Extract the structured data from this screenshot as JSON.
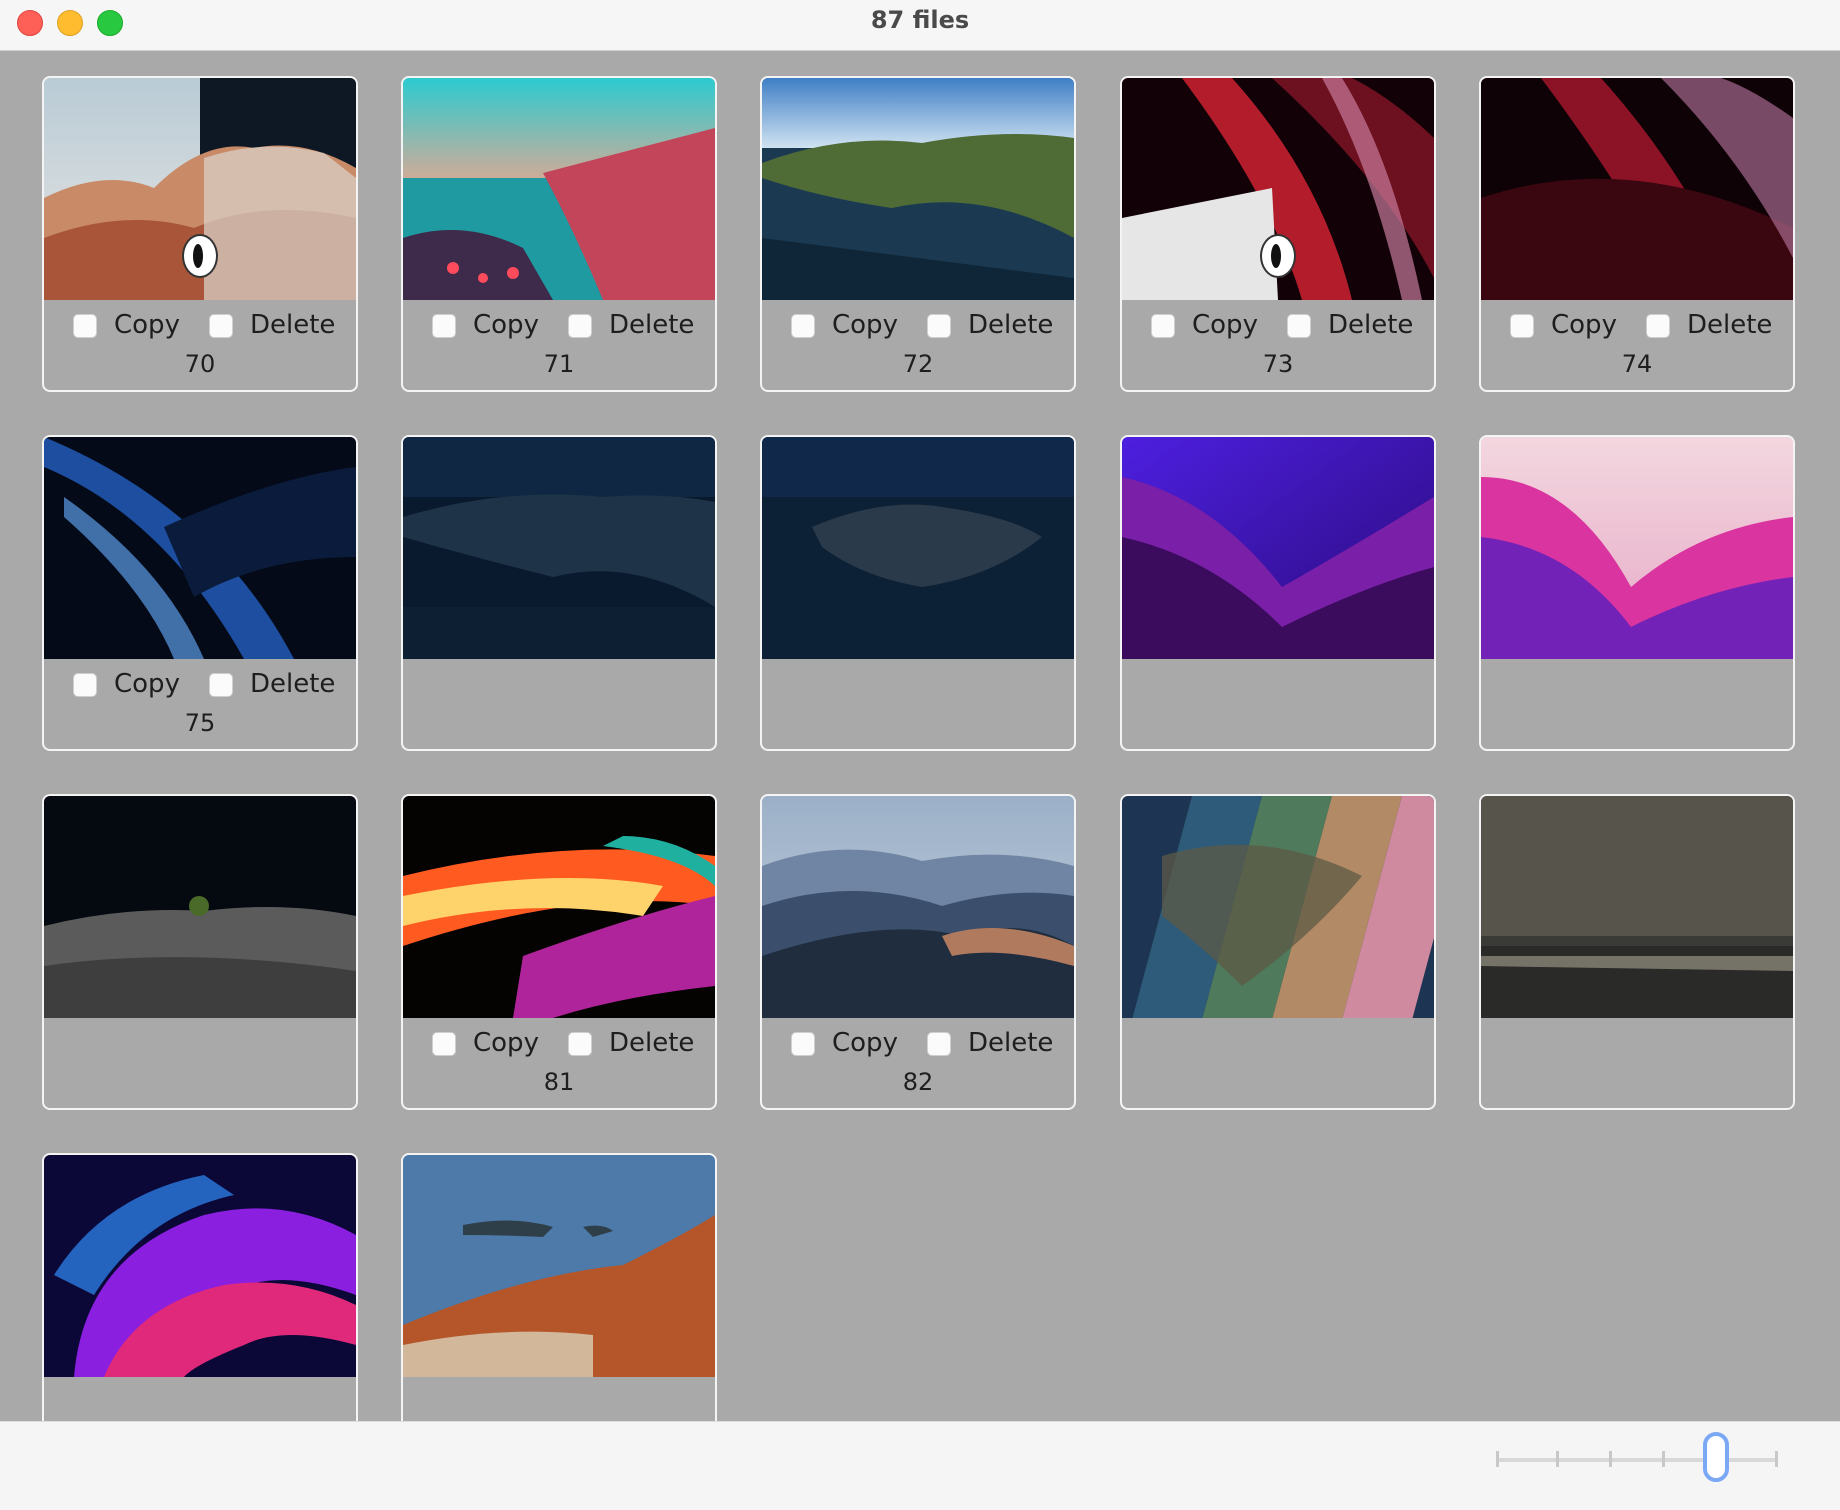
{
  "window": {
    "title": "87 files"
  },
  "labels": {
    "copy": "Copy",
    "delete": "Delete"
  },
  "cards": [
    {
      "number": "70",
      "controls": true,
      "toggle": true,
      "thumb": "cliffs-day-night"
    },
    {
      "number": "71",
      "controls": true,
      "toggle": false,
      "thumb": "illustrated-coast"
    },
    {
      "number": "72",
      "controls": true,
      "toggle": false,
      "thumb": "coast-aerial"
    },
    {
      "number": "73",
      "controls": true,
      "toggle": true,
      "thumb": "red-waves-light"
    },
    {
      "number": "74",
      "controls": true,
      "toggle": false,
      "thumb": "red-waves"
    },
    {
      "number": "75",
      "controls": true,
      "toggle": false,
      "thumb": "blue-waves"
    },
    {
      "controls": false,
      "thumb": "coast-night"
    },
    {
      "controls": false,
      "thumb": "island-night"
    },
    {
      "controls": false,
      "thumb": "purple-hills"
    },
    {
      "controls": false,
      "thumb": "pink-hills"
    },
    {
      "controls": false,
      "thumb": "rock-night"
    },
    {
      "number": "81",
      "controls": true,
      "toggle": false,
      "thumb": "color-streaks"
    },
    {
      "number": "82",
      "controls": true,
      "toggle": false,
      "thumb": "blue-mountains"
    },
    {
      "controls": false,
      "thumb": "island-strips"
    },
    {
      "controls": false,
      "thumb": "stormy-sea"
    },
    {
      "controls": false,
      "thumb": "purple-swirl"
    },
    {
      "controls": false,
      "thumb": "rocky-shore"
    }
  ],
  "colors": {
    "background": "#a9a9a9",
    "accent": "#7aa8f5",
    "footer": "#f5f5f5"
  }
}
